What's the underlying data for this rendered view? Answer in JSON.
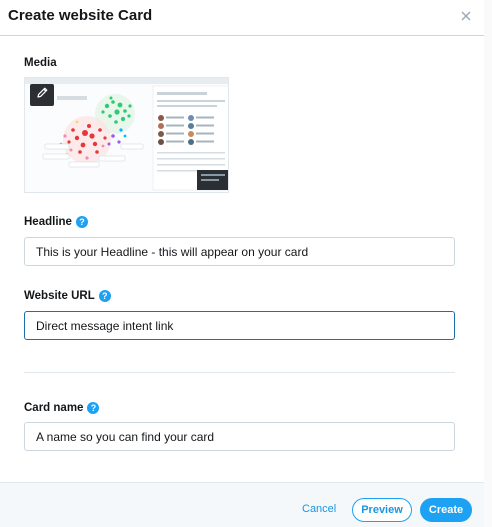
{
  "modal": {
    "title": "Create website Card",
    "close_icon": "close-icon"
  },
  "media": {
    "label": "Media",
    "edit_icon": "pencil-icon"
  },
  "headline": {
    "label": "Headline",
    "value": "This is your Headline - this will appear on your card"
  },
  "website_url": {
    "label": "Website URL",
    "value": "Direct message intent link"
  },
  "card_name": {
    "label": "Card name",
    "value": "A name so you can find your card"
  },
  "help_icon_glyph": "?",
  "footer": {
    "cancel_label": "Cancel",
    "preview_label": "Preview",
    "create_label": "Create"
  },
  "colors": {
    "accent": "#1da1f2",
    "link": "#1b95e0",
    "focus_border": "#1d6fa5",
    "footer_bg": "#f5f8fa"
  }
}
